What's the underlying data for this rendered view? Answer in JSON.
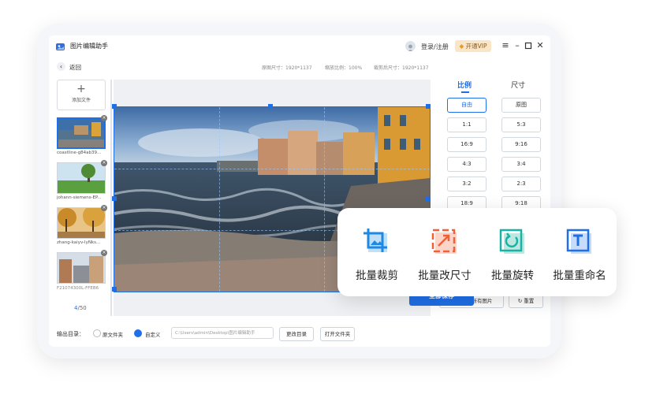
{
  "app": {
    "title": "图片编辑助手",
    "login_label": "登录/注册",
    "vip_label": "开通VIP"
  },
  "toolbar": {
    "back_label": "返回",
    "original_size": "原图尺寸：1920*1137",
    "zoom": "缩放比例：100%",
    "cropped_size": "裁剪后尺寸：1920*1137"
  },
  "files": {
    "add_label": "添加文件",
    "items": [
      {
        "name": "coastline-g84ab39..."
      },
      {
        "name": "johann-siemens-EP..."
      },
      {
        "name": "zhang-kaiyv-lyNks..."
      },
      {
        "name": "F21074300L-FFEB6"
      }
    ],
    "counter_current": "4",
    "counter_total": "/50"
  },
  "panel": {
    "tab_ratio": "比例",
    "tab_size": "尺寸",
    "ratios": [
      "自由",
      "原图",
      "1:1",
      "5:3",
      "16:9",
      "9:16",
      "4:3",
      "3:4",
      "3:2",
      "2:3",
      "18:9",
      "9:18"
    ],
    "active_ratio": "自由",
    "apply_all_label": "应用到所有图片",
    "reset_label": "重置"
  },
  "output": {
    "label": "输出目录：",
    "option_original": "原文件夹",
    "option_custom": "自定义",
    "path_value": "C:\\Users\\admin\\Desktop\\图片编辑助手",
    "change_dir_label": "更改目录",
    "open_folder_label": "打开文件夹",
    "save_all_label": "全部保存"
  },
  "features": [
    {
      "label": "批量裁剪",
      "icon": "crop-icon"
    },
    {
      "label": "批量改尺寸",
      "icon": "resize-icon"
    },
    {
      "label": "批量旋转",
      "icon": "rotate-icon"
    },
    {
      "label": "批量重命名",
      "icon": "rename-icon"
    }
  ],
  "colors": {
    "accent": "#1e6fe8",
    "crop_icon": "#1e88e5",
    "resize_icon": "#f0613a",
    "rotate_icon": "#18b3a4",
    "rename_icon": "#1e6fe8"
  }
}
